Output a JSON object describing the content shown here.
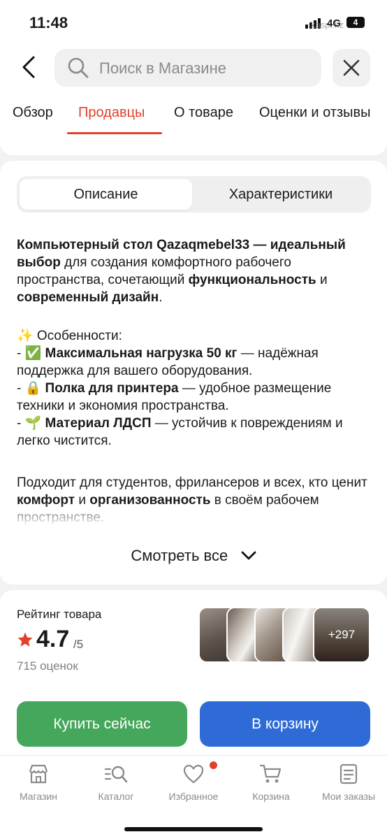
{
  "status_bar": {
    "time": "11:48",
    "network": "4G",
    "battery": "4",
    "watermark": "kaspi.kz"
  },
  "header": {
    "search_placeholder": "Поиск в Магазине"
  },
  "tabs": [
    {
      "label": "Обзор"
    },
    {
      "label": "Продавцы"
    },
    {
      "label": "О товаре"
    },
    {
      "label": "Оценки и отзывы"
    }
  ],
  "active_tab": "Продавцы",
  "segments": {
    "description": "Описание",
    "specs": "Характеристики"
  },
  "description": {
    "p1": {
      "b1": "Компьютерный стол Qazaqmebel33 — идеальный выбор",
      "t1": " для создания комфортного рабочего пространства, сочетающий ",
      "b2": "функциональность",
      "t2": " и ",
      "b3": "современный дизайн",
      "t3": "."
    },
    "features_title": "✨ Особенности:",
    "features": [
      {
        "prefix": "- ✅ ",
        "bold": "Максимальная нагрузка 50 кг",
        "text": " — надёжная поддержка для вашего оборудования."
      },
      {
        "prefix": "- 🔒 ",
        "bold": "Полка для принтера",
        "text": " — удобное размещение техники и экономия пространства."
      },
      {
        "prefix": "- 🌱 ",
        "bold": "Материал ЛДСП",
        "text": " — устойчив к повреждениям и легко чистится."
      }
    ],
    "p3": {
      "t1": "Подходит для студентов, фрилансеров и всех, кто ценит ",
      "b1": "комфорт",
      "t2": " и ",
      "b2": "организованность",
      "t3": " в своём рабочем пространстве."
    },
    "see_all": "Смотреть все"
  },
  "rating": {
    "title": "Рейтинг товара",
    "value": "4.7",
    "max": "/5",
    "count": "715 оценок",
    "more_photos": "+297",
    "star_color": "#e0412c"
  },
  "actions": {
    "buy_now": "Купить сейчас",
    "add_to_cart": "В корзину",
    "buy_color": "#45a75b",
    "cart_color": "#2f6bd6"
  },
  "bottom_nav": [
    {
      "label": "Магазин",
      "icon": "shop-icon"
    },
    {
      "label": "Каталог",
      "icon": "catalog-search-icon"
    },
    {
      "label": "Избранное",
      "icon": "heart-icon"
    },
    {
      "label": "Корзина",
      "icon": "cart-icon"
    },
    {
      "label": "Мои заказы",
      "icon": "orders-icon"
    }
  ],
  "accent_color": "#e0412c"
}
